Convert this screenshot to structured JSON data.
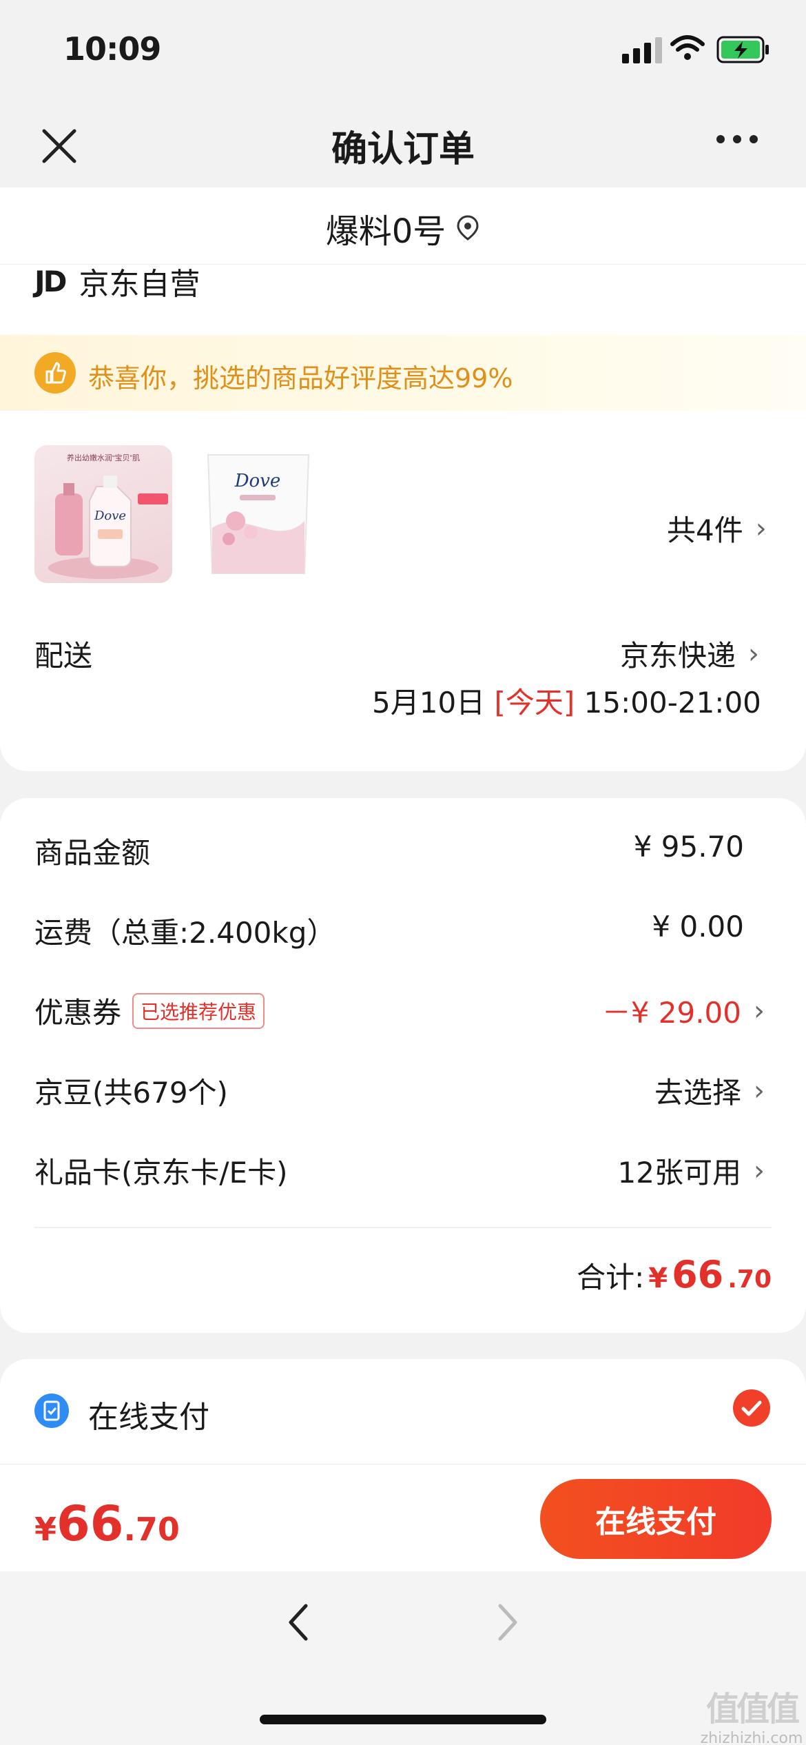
{
  "status_bar": {
    "time": "10:09"
  },
  "navbar": {
    "title": "确认订单"
  },
  "address": {
    "text": "爆料0号"
  },
  "store": {
    "logo": "JD",
    "name": "京东自营"
  },
  "banner": {
    "text": "恭喜你，挑选的商品好评度高达99%"
  },
  "products": {
    "thumb1_brand": "Dove",
    "thumb1_headline": "养出幼嫩水润“宝贝”肌",
    "thumb2_brand": "Dove",
    "count_label": "共4件"
  },
  "delivery": {
    "label": "配送",
    "carrier": "京东快递",
    "date": "5月10日",
    "today": "[今天]",
    "time_window": "15:00-21:00"
  },
  "price_rows": {
    "goods_label": "商品金额",
    "goods_value": "¥ 95.70",
    "shipping_label": "运费（总重:2.400kg）",
    "shipping_value": "¥ 0.00",
    "coupon_label": "优惠券",
    "coupon_badge": "已选推荐优惠",
    "coupon_value": "－¥ 29.00",
    "beans_label": "京豆(共679个)",
    "beans_value": "去选择",
    "giftcard_label": "礼品卡(京东卡/E卡)",
    "giftcard_value": "12张可用",
    "total_label": "合计:",
    "total_yen": "¥",
    "total_int": "66",
    "total_dec": ".70"
  },
  "payment": {
    "method": "在线支付"
  },
  "bottom": {
    "yen": "¥",
    "int": "66",
    "dec": ".70",
    "pay_button": "在线支付"
  },
  "watermark": {
    "top": "值值值",
    "bottom": "zhizhizhi.com"
  },
  "colors": {
    "accent_red": "#e3302a",
    "banner_orange": "#e08f19",
    "pay_blue": "#2f8cf5"
  }
}
